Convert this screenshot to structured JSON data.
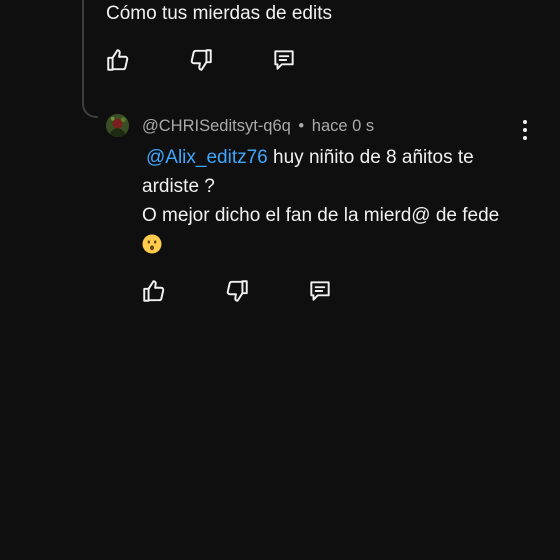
{
  "parent_comment": {
    "text": "Cómo tus mierdas de edits",
    "actions": {
      "like_icon": "thumbs-up-icon",
      "dislike_icon": "thumbs-down-icon",
      "reply_icon": "reply-comment-icon"
    }
  },
  "reply_comment": {
    "author": "@CHRISeditsyt-q6q",
    "separator": "•",
    "time": "hace 0 s",
    "mention": "@Alix_editz76",
    "text_line1": " huy niñito de 8 añitos te ardiste ?",
    "text_line2": "O mejor dicho el fan de la mierd@ de fede",
    "emoji": "hushed-face-emoji",
    "actions": {
      "like_icon": "thumbs-up-icon",
      "dislike_icon": "thumbs-down-icon",
      "reply_icon": "reply-comment-icon"
    },
    "menu_icon": "more-vert-icon"
  },
  "colors": {
    "background": "#0f0f0f",
    "text": "#f1f1f1",
    "secondary_text": "#aaaaaa",
    "mention": "#3ea6ff",
    "thread_line": "#3d3d3d"
  }
}
